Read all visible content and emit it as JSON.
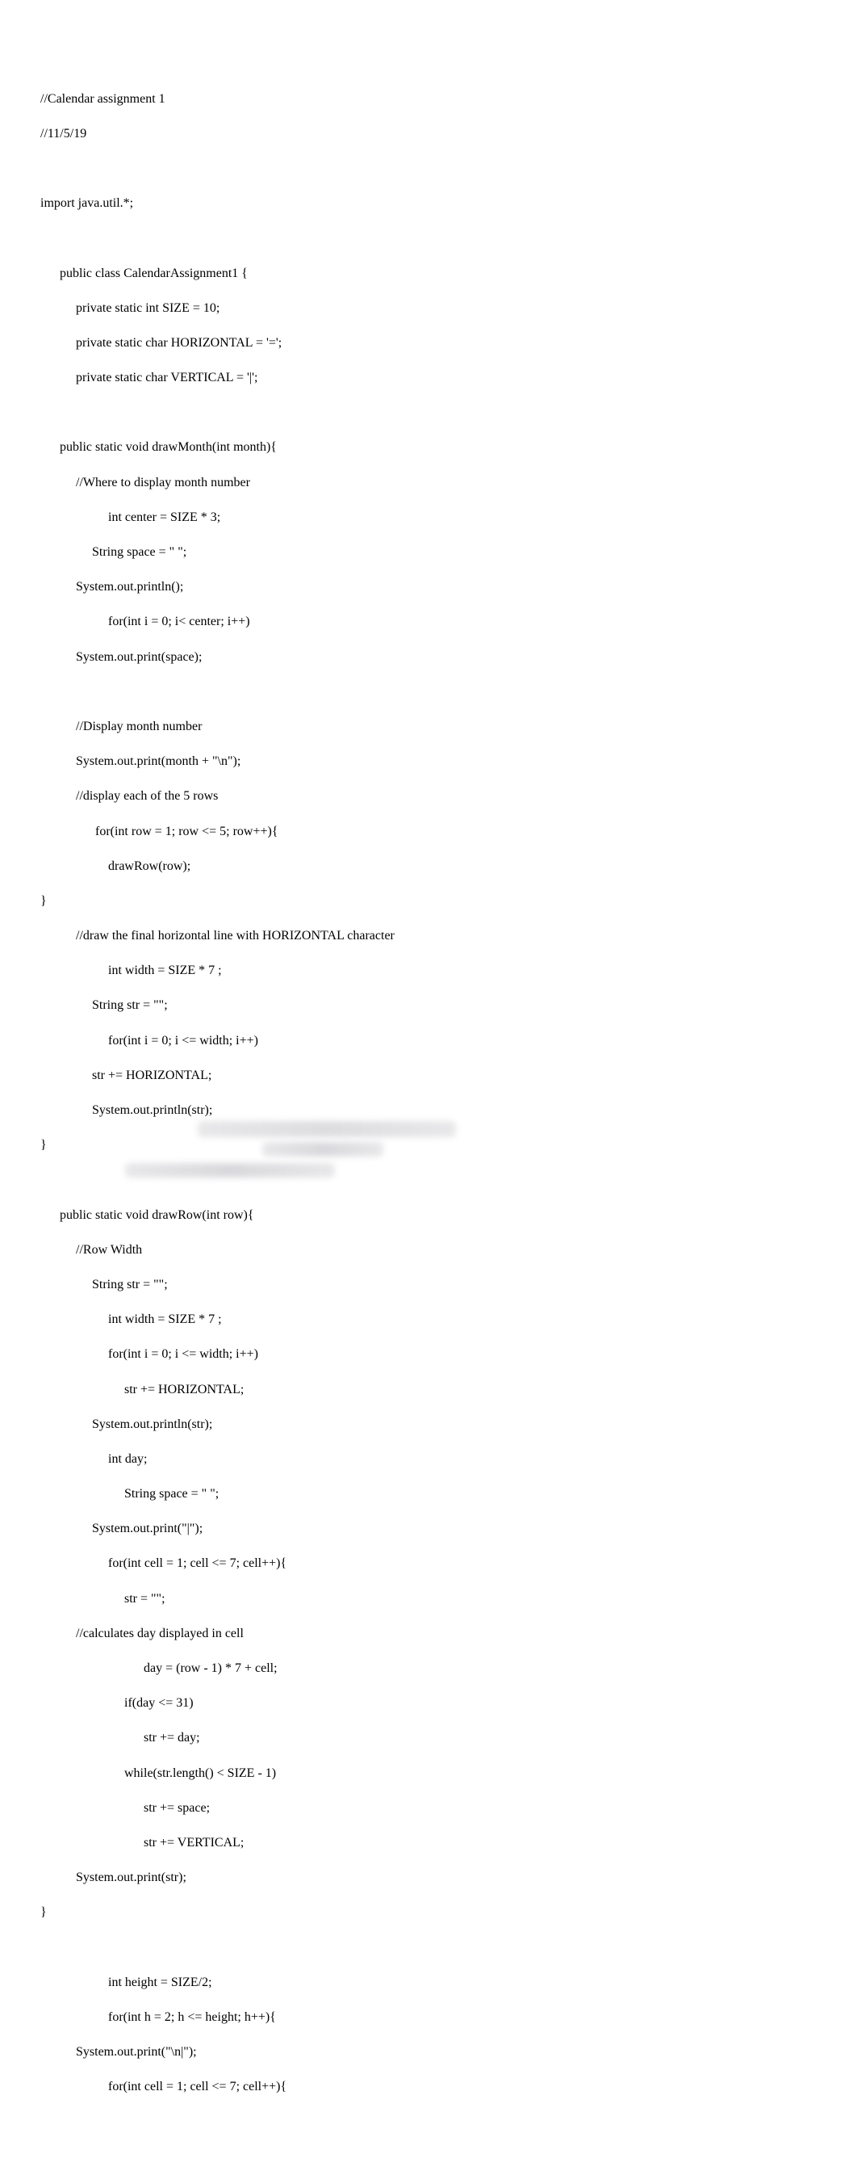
{
  "code": {
    "l1": "//Calendar assignment 1",
    "l2": "//11/5/19",
    "l3": "",
    "l4": "import java.util.*;",
    "l5": "",
    "l6": "      public class CalendarAssignment1 {",
    "l7": "           private static int SIZE = 10;",
    "l8": "           private static char HORIZONTAL = '=';",
    "l9": "           private static char VERTICAL = '|';",
    "l10": "",
    "l11": "      public static void drawMonth(int month){",
    "l12": "           //Where to display month number",
    "l13": "                     int center = SIZE * 3;",
    "l14": "                String space = \" \";",
    "l15": "           System.out.println();",
    "l16": "                     for(int i = 0; i< center; i++)",
    "l17": "           System.out.print(space);",
    "l18": "",
    "l19": "           //Display month number",
    "l20": "           System.out.print(month + \"\\n\");",
    "l21": "           //display each of the 5 rows",
    "l22": "                 for(int row = 1; row <= 5; row++){",
    "l23": "                     drawRow(row);",
    "l24": "}",
    "l25": "           //draw the final horizontal line with HORIZONTAL character",
    "l26": "                     int width = SIZE * 7 ;",
    "l27": "                String str = \"\";",
    "l28": "                     for(int i = 0; i <= width; i++)",
    "l29": "                str += HORIZONTAL;",
    "l30": "                System.out.println(str);",
    "l31": "}",
    "l32": "",
    "l33": "      public static void drawRow(int row){",
    "l34": "           //Row Width",
    "l35": "                String str = \"\";",
    "l36": "                     int width = SIZE * 7 ;",
    "l37": "                     for(int i = 0; i <= width; i++)",
    "l38": "                          str += HORIZONTAL;",
    "l39": "                System.out.println(str);",
    "l40": "                     int day;",
    "l41": "                          String space = \" \";",
    "l42": "                System.out.print(\"|\");",
    "l43": "                     for(int cell = 1; cell <= 7; cell++){",
    "l44": "                          str = \"\";",
    "l45": "           //calculates day displayed in cell",
    "l46": "                                day = (row - 1) * 7 + cell;",
    "l47": "                          if(day <= 31)",
    "l48": "                                str += day;",
    "l49": "                          while(str.length() < SIZE - 1)",
    "l50": "                                str += space;",
    "l51": "                                str += VERTICAL;",
    "l52": "           System.out.print(str);",
    "l53": "}",
    "l54": "",
    "l55": "                     int height = SIZE/2;",
    "l56": "                     for(int h = 2; h <= height; h++){",
    "l57": "           System.out.print(\"\\n|\");",
    "l58": "                     for(int cell = 1; cell <= 7; cell++){"
  }
}
